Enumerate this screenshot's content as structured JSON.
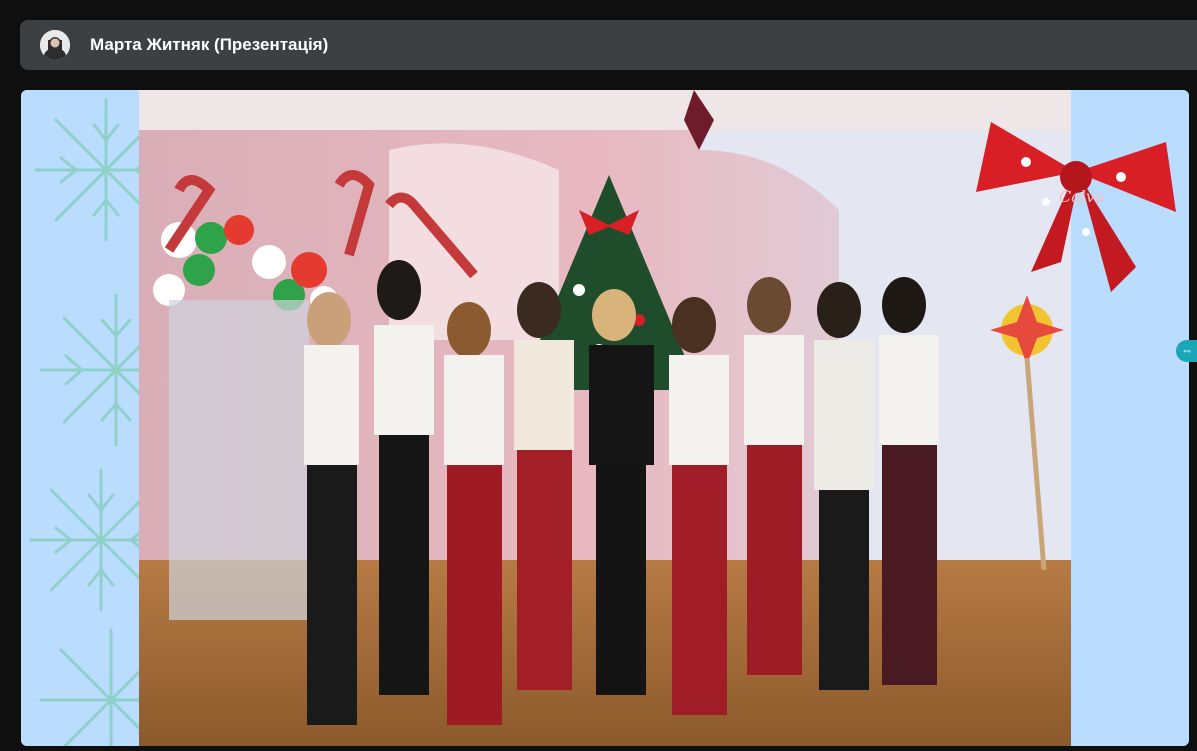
{
  "header": {
    "presenter_title": "Марта Житняк (Презентація)"
  },
  "colors": {
    "background": "#0f0f10",
    "topbar": "#3c4043",
    "slide_background": "#b9dcff",
    "snowflake": "#8fd1c8",
    "bow_red": "#d91f26",
    "handle": "#1aa6b7"
  },
  "slide": {
    "bow_text": "Calva"
  },
  "icons": {
    "avatar": "avatar-icon",
    "snowflake": "snowflake-icon",
    "bow": "bow-icon",
    "expand_handle": "arrow-left-right-icon"
  }
}
